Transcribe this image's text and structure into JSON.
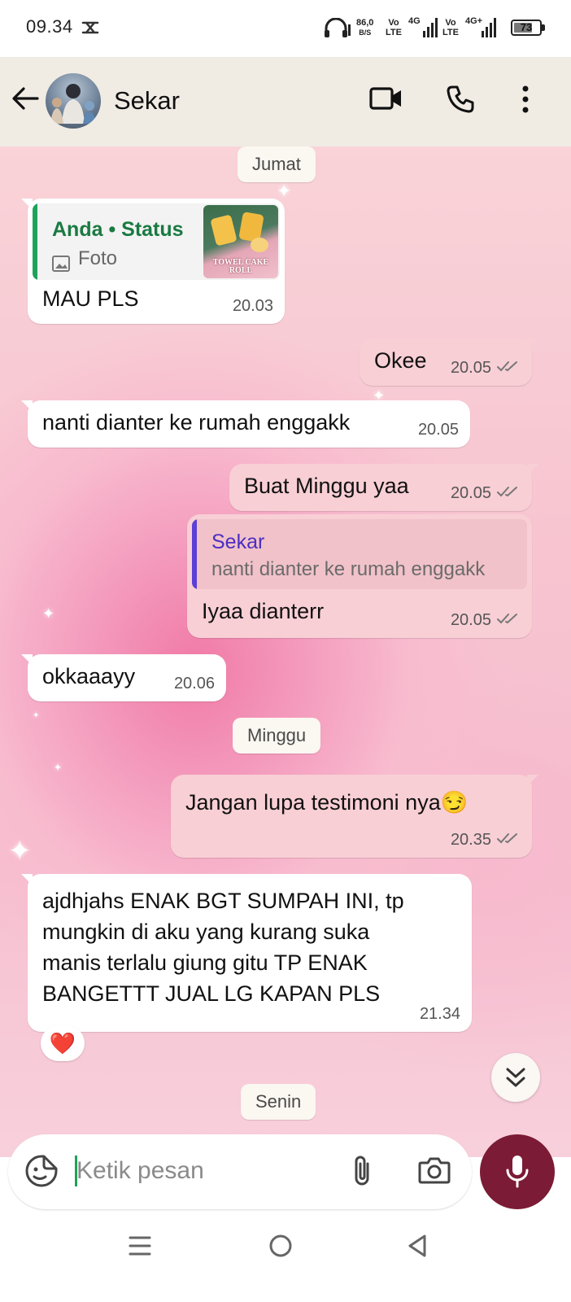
{
  "status_bar": {
    "time": "09.34",
    "net_speed_value": "86,0",
    "net_speed_unit": "B/S",
    "sim1_label_top": "Vo",
    "sim1_label_bottom": "LTE",
    "sim1_net": "4G",
    "sim2_label_top": "Vo",
    "sim2_label_bottom": "LTE",
    "sim2_net": "4G+",
    "battery_level": "73",
    "battery_fraction": 0.73
  },
  "header": {
    "contact_name": "Sekar",
    "icons": [
      "back-arrow-icon",
      "video-call-icon",
      "voice-call-icon",
      "more-vert-icon"
    ]
  },
  "chat": {
    "date_chips": {
      "friday": "Jumat",
      "sunday": "Minggu",
      "monday": "Senin"
    },
    "messages": [
      {
        "direction": "in",
        "quote_title": "Anda • Status",
        "quote_subtitle": "Foto",
        "quote_image_text": "TOWEL CAKE ROLL",
        "text": "MAU PLS",
        "time": "20.03"
      },
      {
        "direction": "out",
        "text": "Okee",
        "time": "20.05"
      },
      {
        "direction": "in",
        "text": "nanti dianter ke rumah enggakk",
        "time": "20.05"
      },
      {
        "direction": "out",
        "text": "Buat Minggu yaa",
        "time": "20.05"
      },
      {
        "direction": "out",
        "quote_title": "Sekar",
        "quote_subtitle": "nanti dianter ke rumah enggakk",
        "text": "Iyaa dianterr",
        "time": "20.05"
      },
      {
        "direction": "in",
        "text": "okkaaayy",
        "time": "20.06"
      },
      {
        "direction": "out",
        "text": "Jangan lupa testimoni nya😏",
        "time": "20.35"
      },
      {
        "direction": "in",
        "lines": [
          "ajdhjahs ENAK BGT SUMPAH INI, tp",
          "mungkin di aku yang kurang suka",
          "manis terlalu giung gitu TP ENAK",
          "BANGETTT JUAL LG KAPAN PLS"
        ],
        "time": "21.34",
        "reaction": "❤️"
      }
    ]
  },
  "composer": {
    "placeholder": "Ketik pesan",
    "icons": [
      "sticker-icon",
      "attach-icon",
      "camera-icon",
      "mic-icon"
    ]
  },
  "colors": {
    "incoming_bubble": "#ffffff",
    "outgoing_bubble": "#f8cfd5",
    "status_quote_bar": "#1ea35a",
    "reply_quote_bar": "#5b3fd6",
    "mic_button": "#7b1b35",
    "header_bg": "#f0ece4"
  }
}
